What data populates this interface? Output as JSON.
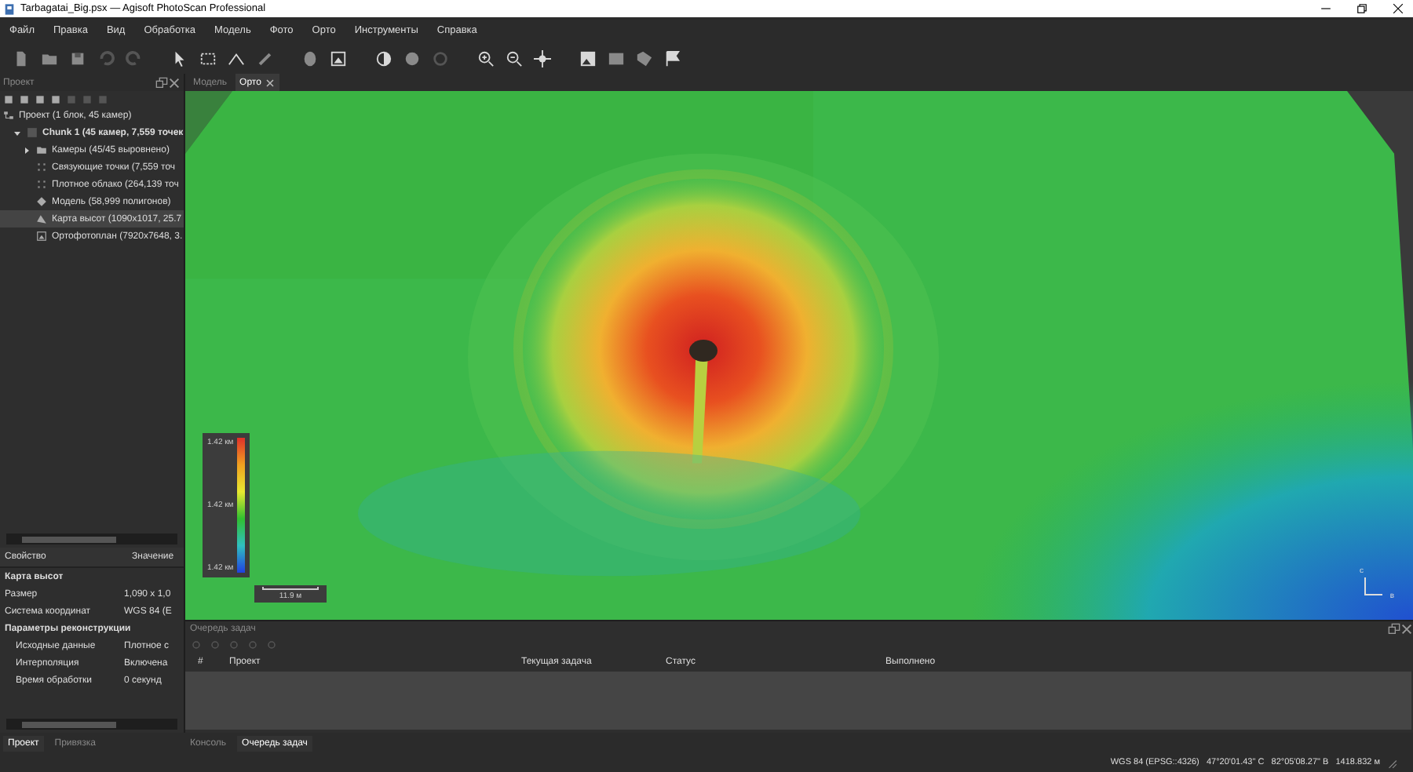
{
  "window": {
    "title": "Tarbagatai_Big.psx — Agisoft PhotoScan Professional"
  },
  "menu": [
    "Файл",
    "Правка",
    "Вид",
    "Обработка",
    "Модель",
    "Фото",
    "Орто",
    "Инструменты",
    "Справка"
  ],
  "project_panel": {
    "title": "Проект",
    "tree": [
      {
        "label": "Проект (1 блок, 45 камер)",
        "kind": "project",
        "selected": false,
        "children": [
          {
            "label": "Chunk 1 (45 камер, 7,559 точек",
            "kind": "chunk",
            "expanded": true,
            "selected": false,
            "children": [
              {
                "label": "Камеры (45/45 выровнено)",
                "kind": "cameras",
                "expanded": false,
                "selected": false
              },
              {
                "label": "Связующие точки (7,559 точ",
                "kind": "points",
                "selected": false
              },
              {
                "label": "Плотное облако (264,139 точ",
                "kind": "points",
                "selected": false
              },
              {
                "label": "Модель (58,999 полигонов)",
                "kind": "model",
                "selected": false
              },
              {
                "label": "Карта высот (1090x1017, 25.7",
                "kind": "dem",
                "selected": true
              },
              {
                "label": "Ортофотоплан (7920x7648, 3.",
                "kind": "ortho",
                "selected": false
              }
            ]
          }
        ]
      }
    ]
  },
  "properties": {
    "columns": [
      "Свойство",
      "Значение"
    ],
    "rows": [
      {
        "kind": "section",
        "name": "Карта высот"
      },
      {
        "kind": "row",
        "name": "Размер",
        "value": "1,090 x 1,0"
      },
      {
        "kind": "row",
        "name": "Система координат",
        "value": "WGS 84 (E"
      },
      {
        "kind": "section",
        "name": "Параметры реконструкции"
      },
      {
        "kind": "subrow",
        "name": "Исходные данные",
        "value": "Плотное с"
      },
      {
        "kind": "subrow",
        "name": "Интерполяция",
        "value": "Включена"
      },
      {
        "kind": "subrow",
        "name": "Время обработки",
        "value": "0 секунд"
      }
    ]
  },
  "left_tabs": [
    {
      "label": "Проект",
      "selected": true
    },
    {
      "label": "Привязка",
      "selected": false
    }
  ],
  "view_tabs": [
    {
      "label": "Модель",
      "selected": false
    },
    {
      "label": "Орто",
      "selected": true
    }
  ],
  "legend": {
    "labels": [
      "1.42 км",
      "1.42 км",
      "1.42 км"
    ]
  },
  "scale_bar": "11.9 м",
  "axes": {
    "north": "с",
    "east": "в"
  },
  "task_queue": {
    "title": "Очередь задач",
    "columns": [
      "#",
      "Проект",
      "Текущая задача",
      "Статус",
      "Выполнено"
    ]
  },
  "bottom_tabs": [
    {
      "label": "Консоль",
      "selected": false
    },
    {
      "label": "Очередь задач",
      "selected": true
    }
  ],
  "status_bar": "WGS 84 (EPSG::4326)   47°20'01.43\" С   82°05'08.27\" В   1418.832 м"
}
